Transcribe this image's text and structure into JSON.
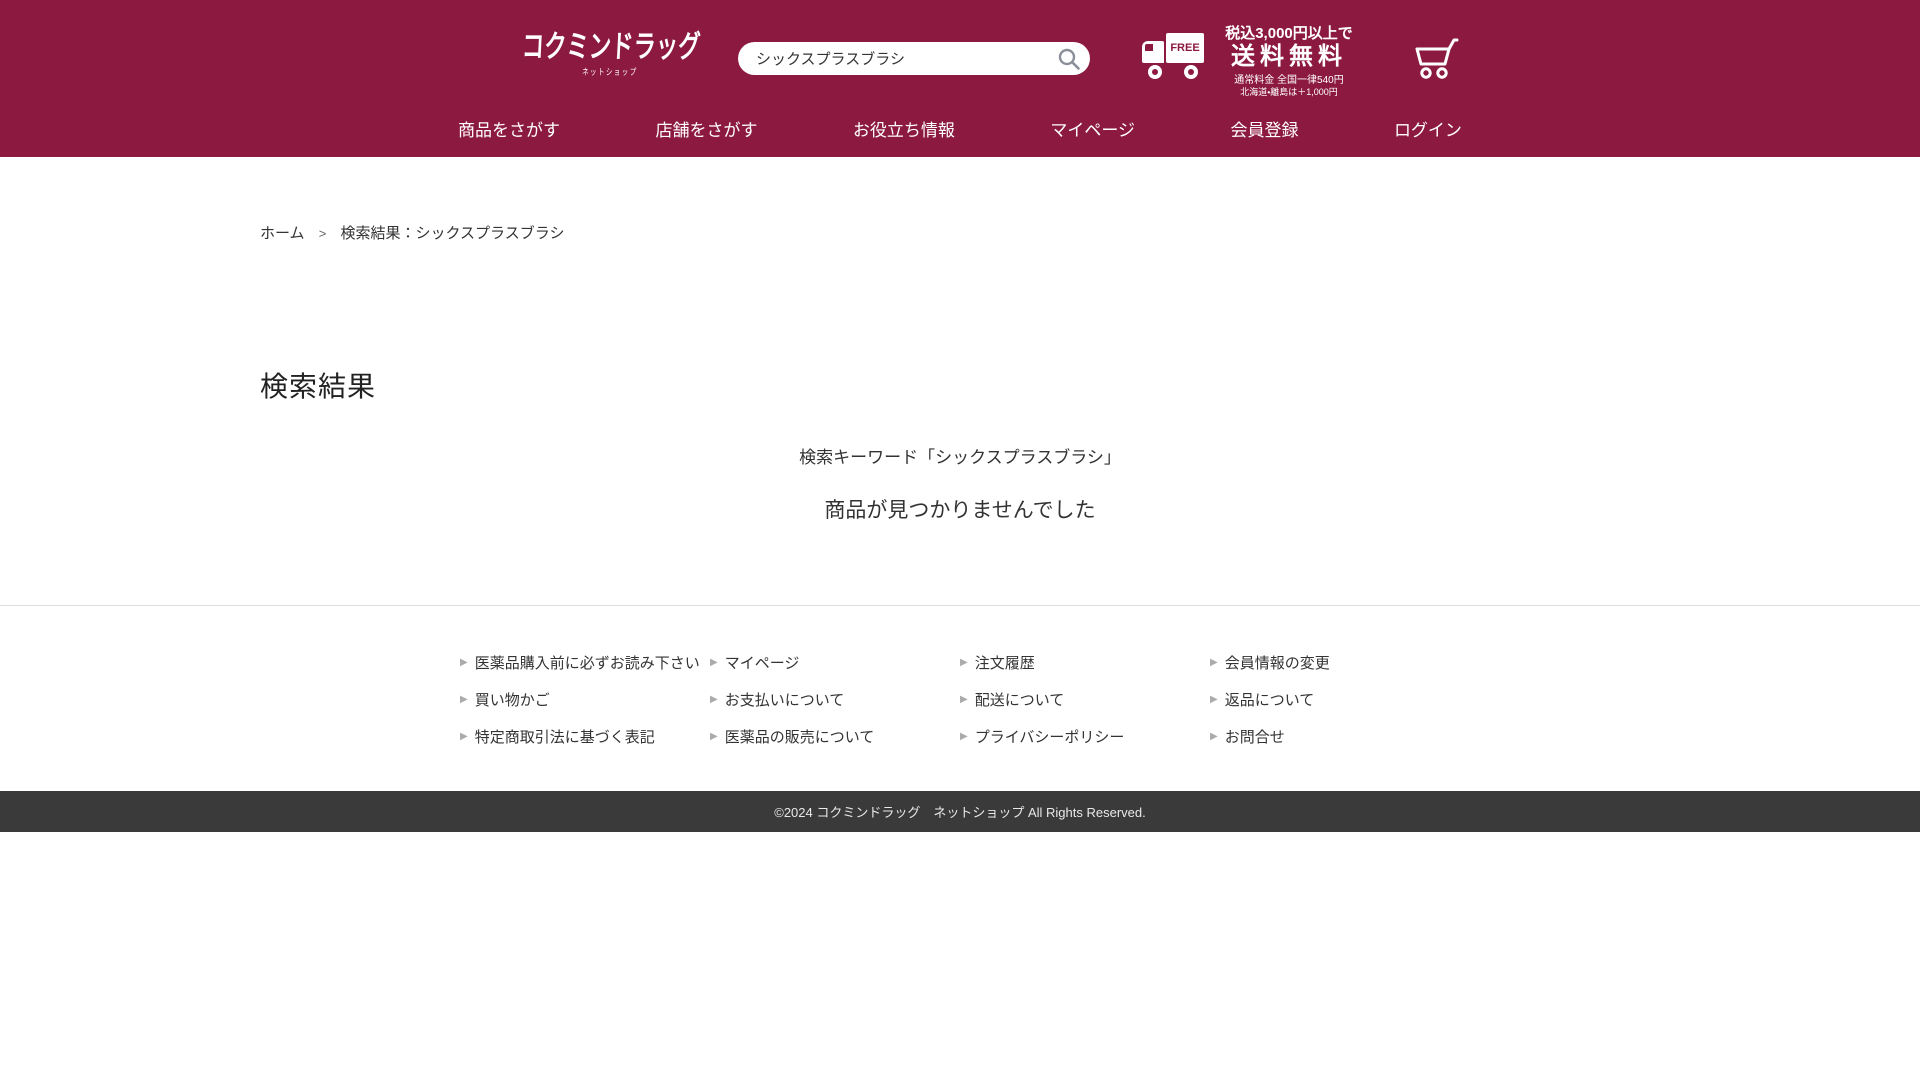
{
  "colors": {
    "brand": "#8C1A40",
    "copyright_bar": "#3A3A3A"
  },
  "header": {
    "logo": {
      "title": "コクミンドラッグ",
      "subtitle": "ネットショップ"
    },
    "search": {
      "value": "シックスプラスブラシ"
    },
    "shipping": {
      "free_label": "FREE",
      "line1": "税込3,000円以上で",
      "line2": "送料無料",
      "line3": "通常料金 全国一律540円",
      "line4": "北海道・離島は＋1,000円"
    },
    "nav": [
      "商品をさがす",
      "店舗をさがす",
      "お役立ち情報",
      "マイページ",
      "会員登録",
      "ログイン"
    ]
  },
  "breadcrumb": {
    "home": "ホーム",
    "separator": ">",
    "current": "検索結果：シックスプラスブラシ"
  },
  "main": {
    "title": "検索結果",
    "keyword_line": "検索キーワード「シックスプラスブラシ」",
    "no_results": "商品が見つかりませんでした"
  },
  "footer": {
    "columns": [
      {
        "links": [
          "医薬品購入前に必ずお読み下さい",
          "買い物かご",
          "特定商取引法に基づく表記"
        ]
      },
      {
        "links": [
          "マイページ",
          "お支払いについて",
          "医薬品の販売について"
        ]
      },
      {
        "links": [
          "注文履歴",
          "配送について",
          "プライバシーポリシー"
        ]
      },
      {
        "links": [
          "会員情報の変更",
          "返品について",
          "お問合せ"
        ]
      }
    ],
    "copyright": "©2024 コクミンドラッグ　ネットショップ All Rights Reserved."
  }
}
